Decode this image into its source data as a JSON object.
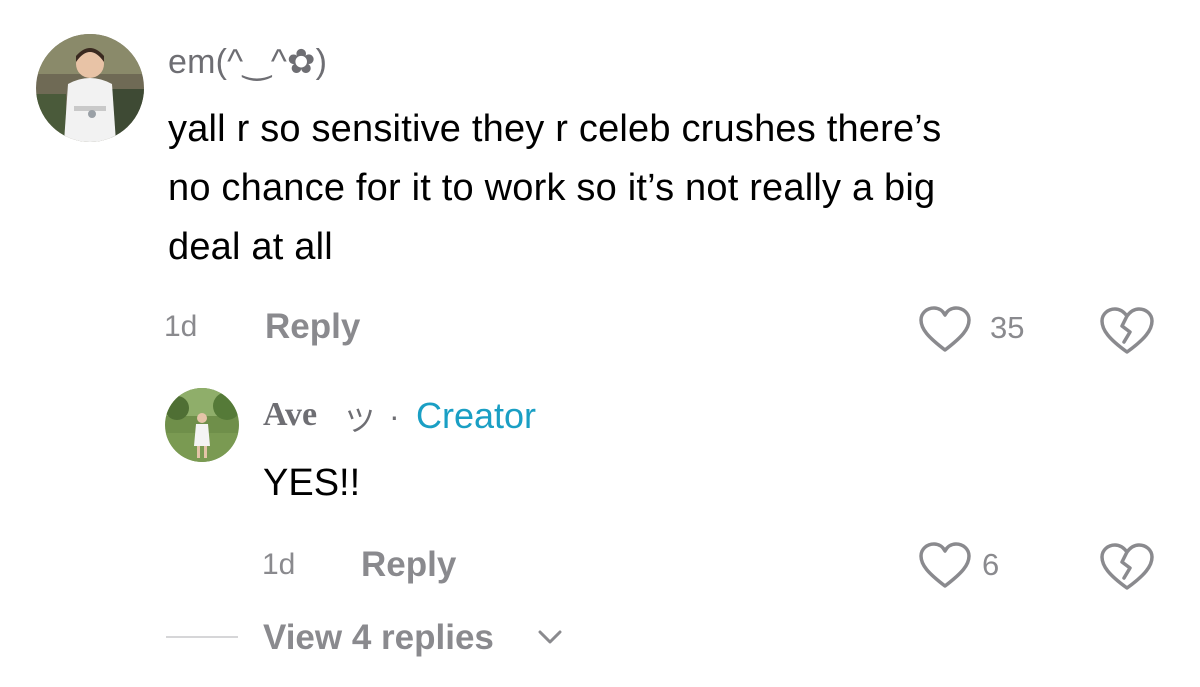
{
  "comment": {
    "username": "em(^‿^✿)",
    "text": "yall r so sensitive they r celeb crushes there’s\nno chance for it to work so it’s not really a big\ndeal at all",
    "time": "1d",
    "reply_label": "Reply",
    "like_count": "35",
    "avatar_icon": "avatar-child-in-white-dress",
    "like_icon": "heart-outline-icon",
    "dislike_icon": "broken-heart-icon"
  },
  "reply": {
    "username": "Ave",
    "username_emoji": "ツ",
    "separator": "·",
    "creator_label": "Creator",
    "text": "YES!!",
    "time": "1d",
    "reply_label": "Reply",
    "like_count": "6",
    "avatar_icon": "avatar-person-in-field"
  },
  "view_replies": {
    "label": "View 4 replies",
    "icon": "chevron-down-icon"
  },
  "colors": {
    "creator_accent": "#1a9fc4",
    "muted_text": "#8a8a8e",
    "primary_text": "#000000",
    "background": "#ffffff"
  }
}
